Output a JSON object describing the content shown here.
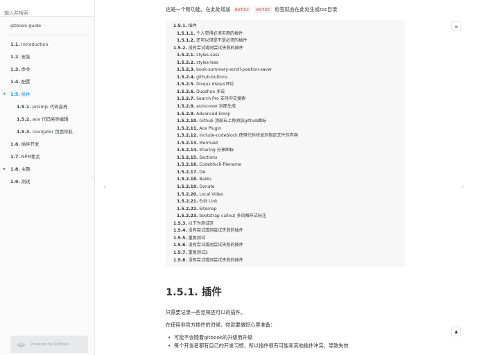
{
  "search": {
    "placeholder": "输入并搜索"
  },
  "sidebar": {
    "items": [
      {
        "num": "",
        "label": "gitbook-guide",
        "level": 0,
        "active": false,
        "arrow": ""
      },
      {
        "num": "1.1.",
        "label": "Introduction",
        "level": 1,
        "active": false,
        "arrow": ""
      },
      {
        "num": "1.2.",
        "label": "安装",
        "level": 1,
        "active": false,
        "arrow": ""
      },
      {
        "num": "1.3.",
        "label": "命令",
        "level": 1,
        "active": false,
        "arrow": ""
      },
      {
        "num": "1.4.",
        "label": "配置",
        "level": 1,
        "active": false,
        "arrow": ""
      },
      {
        "num": "1.5.",
        "label": "插件",
        "level": 1,
        "active": true,
        "arrow": "▾"
      },
      {
        "num": "1.5.1.",
        "label": "prismjs 代码高亮",
        "level": 2,
        "active": false,
        "arrow": ""
      },
      {
        "num": "1.5.2.",
        "label": "ace 代码高亮编辑",
        "level": 2,
        "active": false,
        "arrow": ""
      },
      {
        "num": "1.5.3.",
        "label": "navigator 页面导航",
        "level": 2,
        "active": false,
        "arrow": ""
      },
      {
        "num": "1.6.",
        "label": "插件开发",
        "level": 1,
        "active": false,
        "arrow": ""
      },
      {
        "num": "1.7.",
        "label": "NPM相关",
        "level": 1,
        "active": false,
        "arrow": ""
      },
      {
        "num": "1.8.",
        "label": "主题",
        "level": 1,
        "active": false,
        "arrow": "▸"
      },
      {
        "num": "1.9.",
        "label": "测试",
        "level": 1,
        "active": false,
        "arrow": ""
      }
    ],
    "powered_by": "Powered by GitBook"
  },
  "main": {
    "intro": {
      "before": "这是一个新功能。在此处增加",
      "tag1": "extoc",
      "tag2": "extoc",
      "after": "标签就会在此处生成toc目录"
    },
    "toc": [
      {
        "num": "1.5.1.",
        "text": "插件",
        "depth": 1
      },
      {
        "num": "1.5.1.1.",
        "text": "个人觉得必须实用的插件",
        "depth": 2
      },
      {
        "num": "1.5.1.2.",
        "text": "还可以但是不是必须的插件",
        "depth": 2
      },
      {
        "num": "1.5.2.",
        "text": "没有尝试或则尝试失败的插件",
        "depth": 1
      },
      {
        "num": "1.5.2.1.",
        "text": "styles-sass",
        "depth": 2
      },
      {
        "num": "1.5.2.2.",
        "text": "styles-less",
        "depth": 2
      },
      {
        "num": "1.5.2.3.",
        "text": "book-summary-scroll-position-saver",
        "depth": 2
      },
      {
        "num": "1.5.2.4.",
        "text": "github-buttons",
        "depth": 2
      },
      {
        "num": "1.5.2.5.",
        "text": "Disqus disqus评论",
        "depth": 2
      },
      {
        "num": "1.5.2.6.",
        "text": "Duoshuo 多说",
        "depth": 2
      },
      {
        "num": "1.5.2.7.",
        "text": "Search Pro 支持中文搜索",
        "depth": 2
      },
      {
        "num": "1.5.2.8.",
        "text": "autocover 封面生成",
        "depth": 2
      },
      {
        "num": "1.5.2.9.",
        "text": "Advanced Emoji",
        "depth": 2
      },
      {
        "num": "1.5.2.10.",
        "text": "Github 顶部右上角添加github图标",
        "depth": 2
      },
      {
        "num": "1.5.2.11.",
        "text": "Ace Plugin",
        "depth": 2
      },
      {
        "num": "1.5.2.12.",
        "text": "include-codeblock 使用代码块显示指定文件的内容",
        "depth": 2
      },
      {
        "num": "1.5.2.13.",
        "text": "Mermaid",
        "depth": 2
      },
      {
        "num": "1.5.2.14.",
        "text": "Sharing 分享图标",
        "depth": 2
      },
      {
        "num": "1.5.2.15.",
        "text": "Sectionx",
        "depth": 2
      },
      {
        "num": "1.5.2.16.",
        "text": "Codeblock-filename",
        "depth": 2
      },
      {
        "num": "1.5.2.17.",
        "text": "GA",
        "depth": 2
      },
      {
        "num": "1.5.2.18.",
        "text": "Baidu",
        "depth": 2
      },
      {
        "num": "1.5.2.19.",
        "text": "Donate",
        "depth": 2
      },
      {
        "num": "1.5.2.20.",
        "text": "Local Video",
        "depth": 2
      },
      {
        "num": "1.5.2.21.",
        "text": "Edit Link",
        "depth": 2
      },
      {
        "num": "1.5.2.22.",
        "text": "Sitemap",
        "depth": 2
      },
      {
        "num": "1.5.2.23.",
        "text": "bootstrap-callout 多风格样式标注",
        "depth": 2
      },
      {
        "num": "1.5.3.",
        "text": "以下为测试区",
        "depth": 1
      },
      {
        "num": "1.5.4.",
        "text": "没有尝试或则尝试失败的插件",
        "depth": 1
      },
      {
        "num": "1.5.5.",
        "text": "重复测试",
        "depth": 1
      },
      {
        "num": "1.5.6.",
        "text": "没有尝试或则尝试失败的插件",
        "depth": 1
      },
      {
        "num": "1.5.7.",
        "text": "重复测试2",
        "depth": 1
      },
      {
        "num": "1.5.8.",
        "text": "没有尝试或则尝试失败的插件",
        "depth": 1
      }
    ],
    "heading": "1.5.1. 插件",
    "para1": "只需要记录一些觉得还可以的插件。",
    "para2": "在使用非官方插件的时候，你就要做好心里准备：",
    "bullets": [
      "可能不会随着gitbook的升级而升级",
      "每个开发者都有自己的开发习惯，所以插件很有可能和其他插件冲突，导致失效"
    ]
  },
  "icons": {
    "prev": "chevron-left-icon",
    "next": "chevron-right-icon",
    "menu": "menu-icon",
    "top": "arrow-up-icon"
  },
  "colors": {
    "accent": "#008cff",
    "code_tag": "#e04242",
    "toc_bg": "#f7f7f7"
  }
}
